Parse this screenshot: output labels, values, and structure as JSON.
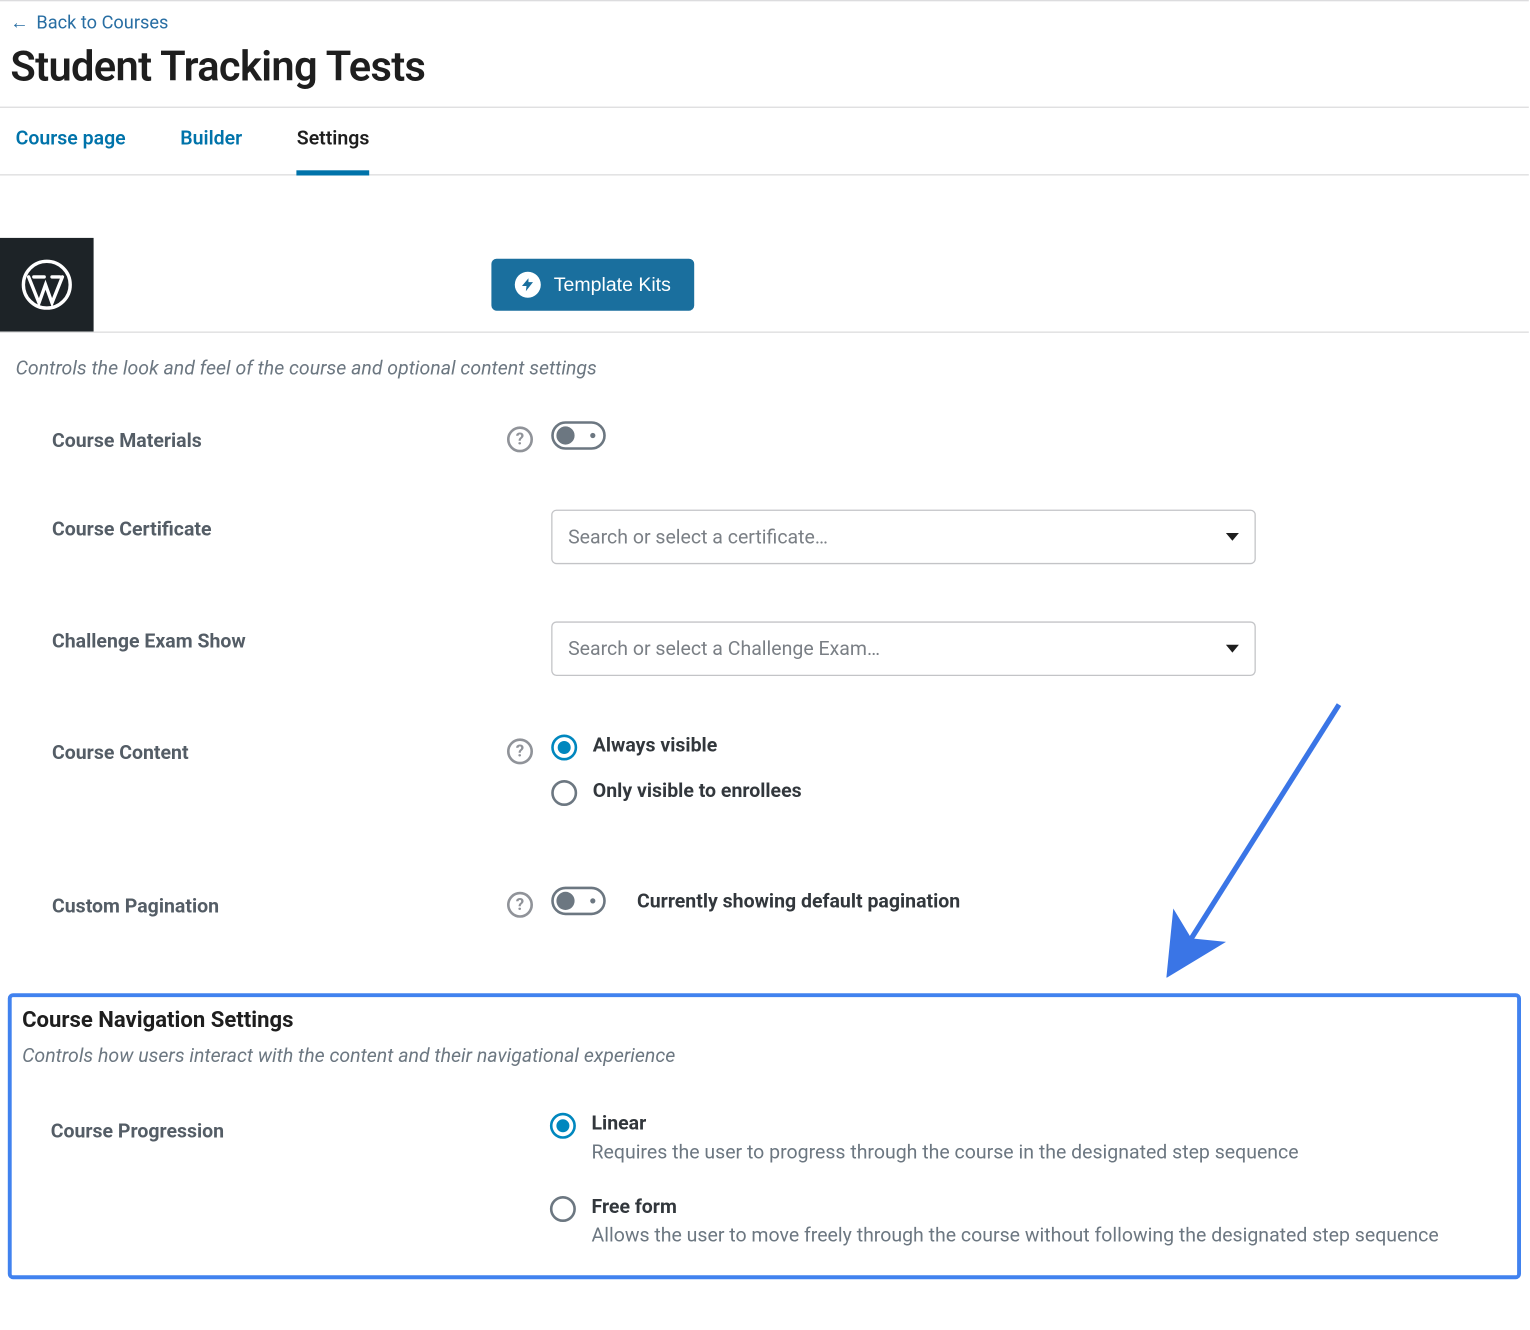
{
  "back": {
    "text": "Back to Courses",
    "arrow": "←"
  },
  "page_title": "Student Tracking Tests",
  "tabs": {
    "course_page": "Course page",
    "builder": "Builder",
    "settings": "Settings"
  },
  "template_kits_label": "Template Kits",
  "display_section_desc": "Controls the look and feel of the course and optional content settings",
  "labels": {
    "course_materials": "Course Materials",
    "course_certificate": "Course Certificate",
    "challenge_exam": "Challenge Exam Show",
    "course_content": "Course Content",
    "custom_pagination": "Custom Pagination"
  },
  "certificate_placeholder": "Search or select a certificate…",
  "challenge_placeholder": "Search or select a Challenge Exam…",
  "content_options": {
    "always": "Always visible",
    "enrollees": "Only visible to enrollees"
  },
  "pagination_status": "Currently showing default pagination",
  "nav": {
    "title": "Course Navigation Settings",
    "desc": "Controls how users interact with the content and their navigational experience",
    "progression_label": "Course Progression",
    "linear": "Linear",
    "linear_desc": "Requires the user to progress through the course in the designated step sequence",
    "free": "Free form",
    "free_desc": "Allows the user to move freely through the course without following the designated step sequence"
  },
  "help_glyph": "?"
}
